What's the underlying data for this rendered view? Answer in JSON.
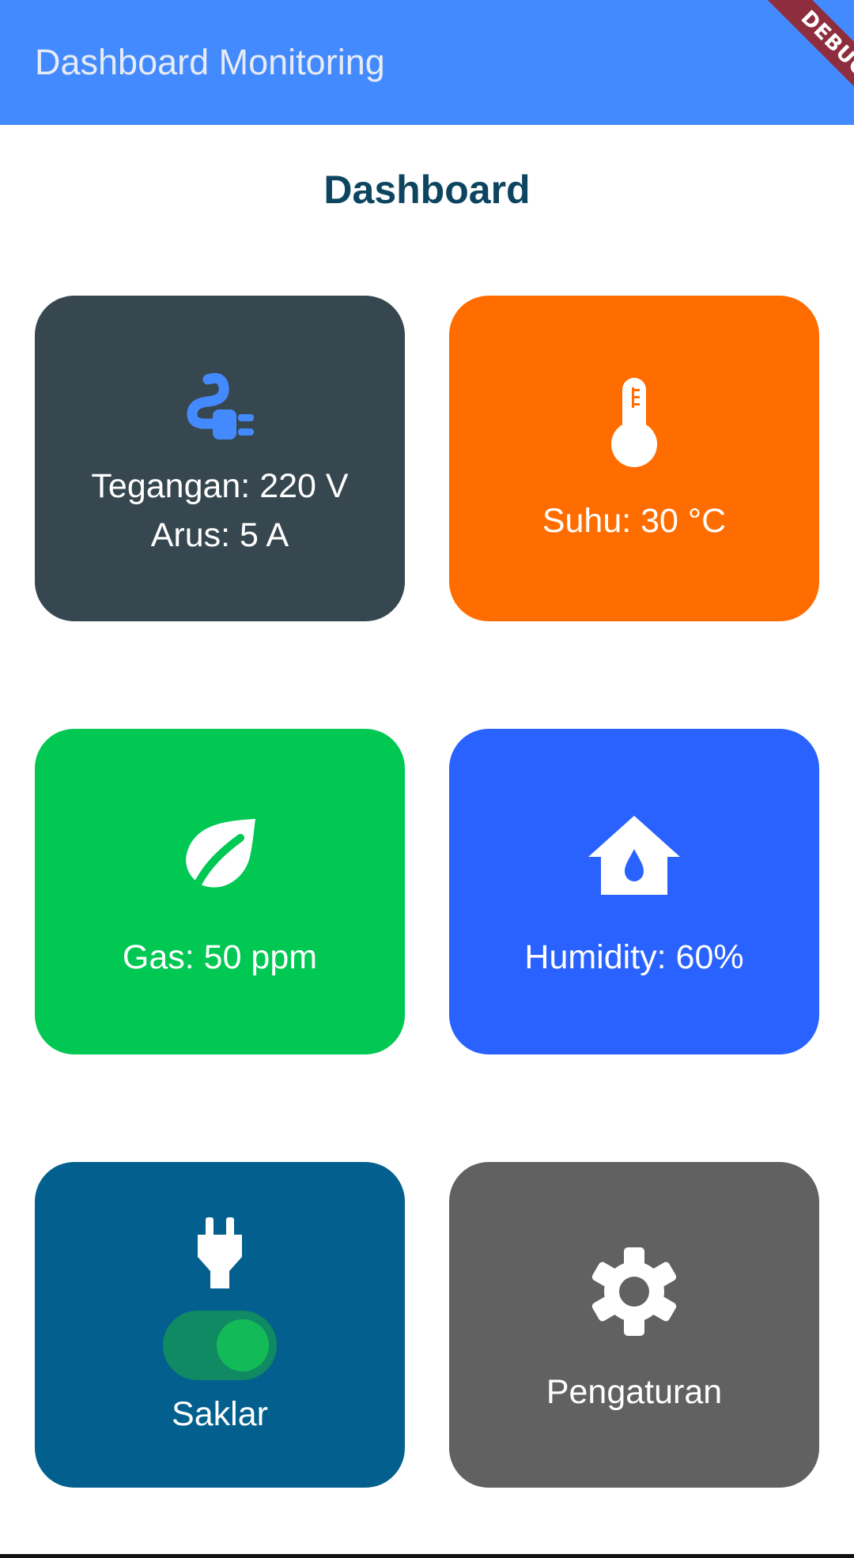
{
  "appbar": {
    "title": "Dashboard Monitoring",
    "debug_banner": "DEBUG",
    "color": "#448aff"
  },
  "page": {
    "title": "Dashboard"
  },
  "cards": {
    "power": {
      "icon": "power-cable-icon",
      "voltage_label": "Tegangan: 220 V",
      "current_label": "Arus: 5 A",
      "color": "#37474f"
    },
    "temperature": {
      "icon": "thermometer-icon",
      "label": "Suhu: 30 °C",
      "color": "#ff6d00"
    },
    "gas": {
      "icon": "leaf-icon",
      "label": "Gas: 50 ppm",
      "color": "#00c853"
    },
    "humidity": {
      "icon": "water-drop-house-icon",
      "label": "Humidity: 60%",
      "color": "#2962ff"
    },
    "switch": {
      "icon": "plug-icon",
      "label": "Saklar",
      "on": true,
      "color": "#03608e"
    },
    "settings": {
      "icon": "gear-icon",
      "label": "Pengaturan",
      "color": "#616161"
    }
  }
}
